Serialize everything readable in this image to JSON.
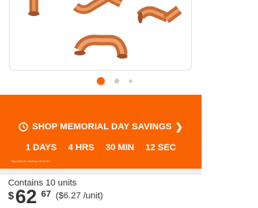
{
  "gallery": {
    "image_alt": "copper elbow fittings",
    "page_count": 3,
    "active_page": 1
  },
  "promo": {
    "banner_label": "SHOP MEMORIAL DAY SAVINGS",
    "chevron": "❯",
    "countdown": [
      "1 DAYS",
      "4 HRS",
      "30 MIN",
      "12 SEC"
    ],
    "fineprint": "*Appliance Savings End 6/4",
    "background_color": "#f96302"
  },
  "product": {
    "units_text": "Contains 10 units",
    "currency": "$",
    "price_dollars": "62",
    "price_cents": "67",
    "unit_price": "($6.27 /unit)"
  }
}
